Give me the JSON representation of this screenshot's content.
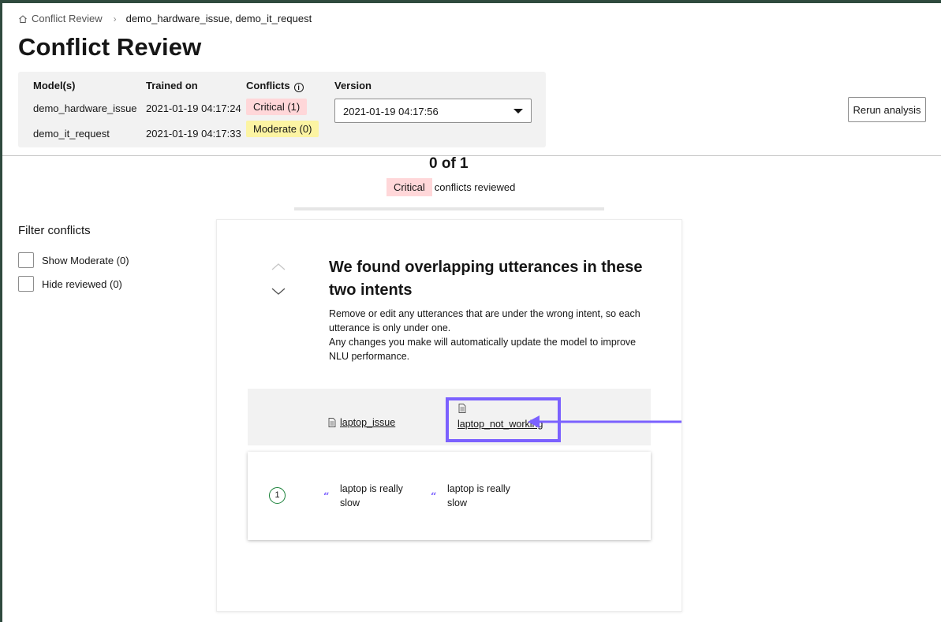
{
  "breadcrumb": {
    "root": "Conflict Review",
    "current": "demo_hardware_issue, demo_it_request"
  },
  "page_title": "Conflict Review",
  "info_panel": {
    "headers": {
      "models": "Model(s)",
      "trained_on": "Trained on",
      "conflicts": "Conflicts",
      "version": "Version"
    },
    "models": [
      {
        "name": "demo_hardware_issue",
        "trained_on": "2021-01-19 04:17:24"
      },
      {
        "name": "demo_it_request",
        "trained_on": "2021-01-19 04:17:33"
      }
    ],
    "conflict_tags": {
      "critical": "Critical (1)",
      "moderate": "Moderate (0)"
    },
    "version_select": {
      "selected": "2021-01-19 04:17:56"
    }
  },
  "rerun_button": "Rerun analysis",
  "progress": {
    "count": "0 of 1",
    "tag": "Critical",
    "suffix": "conflicts reviewed",
    "fraction": 0
  },
  "filters": {
    "title": "Filter conflicts",
    "options": [
      {
        "label": "Show Moderate (0)",
        "checked": false
      },
      {
        "label": "Hide reviewed (0)",
        "checked": false
      }
    ]
  },
  "conflict_card": {
    "heading": "We found overlapping utterances in these two intents",
    "desc_line1": "Remove or edit any utterances that are under the wrong intent, so each utterance is only under one.",
    "desc_line2": "Any changes you make will automatically update the model to improve NLU performance.",
    "intent_a": "laptop_issue",
    "intent_b": "laptop_not_working",
    "utterance_row": {
      "number": "1",
      "left": "laptop is really slow",
      "right": "laptop is really slow"
    }
  },
  "colors": {
    "critical": "#ffd7d9",
    "moderate": "#fcf4a3",
    "highlight": "#7b61ff",
    "success": "#198038"
  }
}
